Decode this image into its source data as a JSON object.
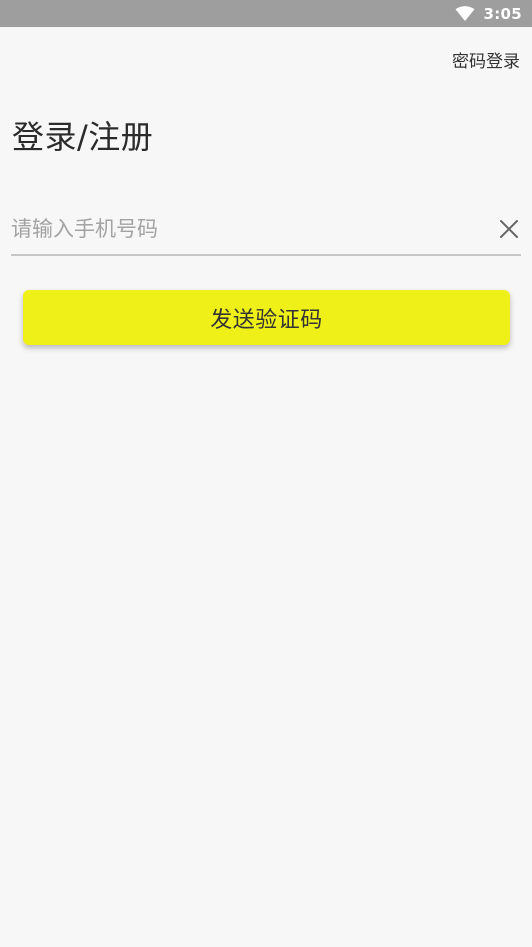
{
  "status_bar": {
    "time": "3:05",
    "icons": [
      "wifi-icon"
    ]
  },
  "header": {
    "password_login_label": "密码登录"
  },
  "main": {
    "title": "登录/注册",
    "phone_input": {
      "placeholder": "请输入手机号码",
      "value": ""
    },
    "clear_icon": "close-icon",
    "send_code_label": "发送验证码"
  },
  "colors": {
    "status_bar": "#9e9e9e",
    "background": "#f7f7f7",
    "accent_button": "#f0f019",
    "title_text": "#2b2b2b",
    "placeholder_text": "#a3a3a3",
    "divider": "#c6c6c6"
  }
}
